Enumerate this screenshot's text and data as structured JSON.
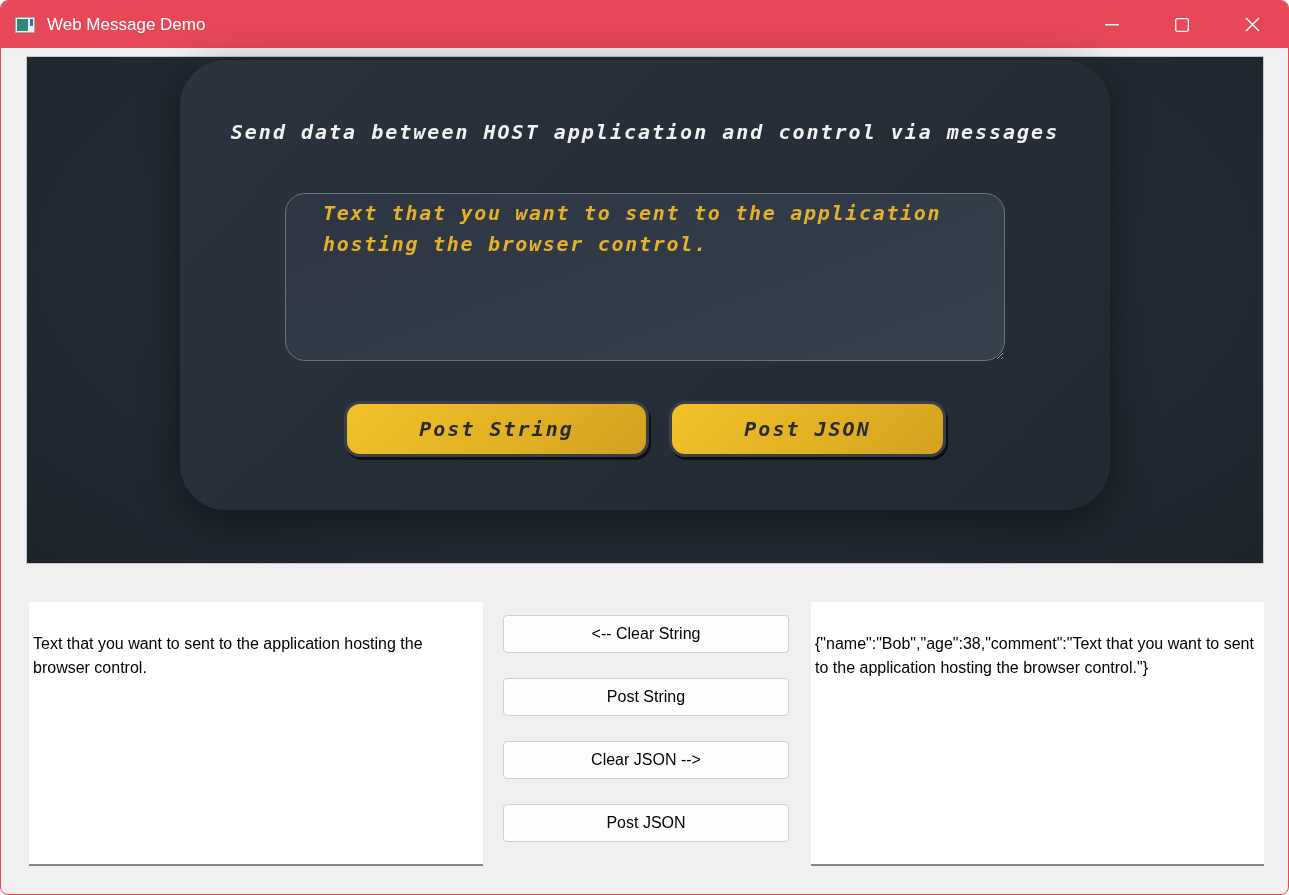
{
  "window": {
    "title": "Web Message Demo"
  },
  "browser": {
    "heading": "Send data between HOST application and control via messages",
    "message": {
      "value": "Text that you want to sent to the application hosting the browser control."
    },
    "buttons": [
      "Post String",
      "Post JSON"
    ]
  },
  "host": {
    "received_string": "Text that you want to sent to the application hosting the browser control.",
    "buttons": [
      "<-- Clear String",
      "Post String",
      "Clear JSON -->",
      "Post JSON"
    ],
    "received_json": "{\"name\":\"Bob\",\"age\":38,\"comment\":\"Text that you want to sent to the application hosting the browser control.\"}"
  }
}
